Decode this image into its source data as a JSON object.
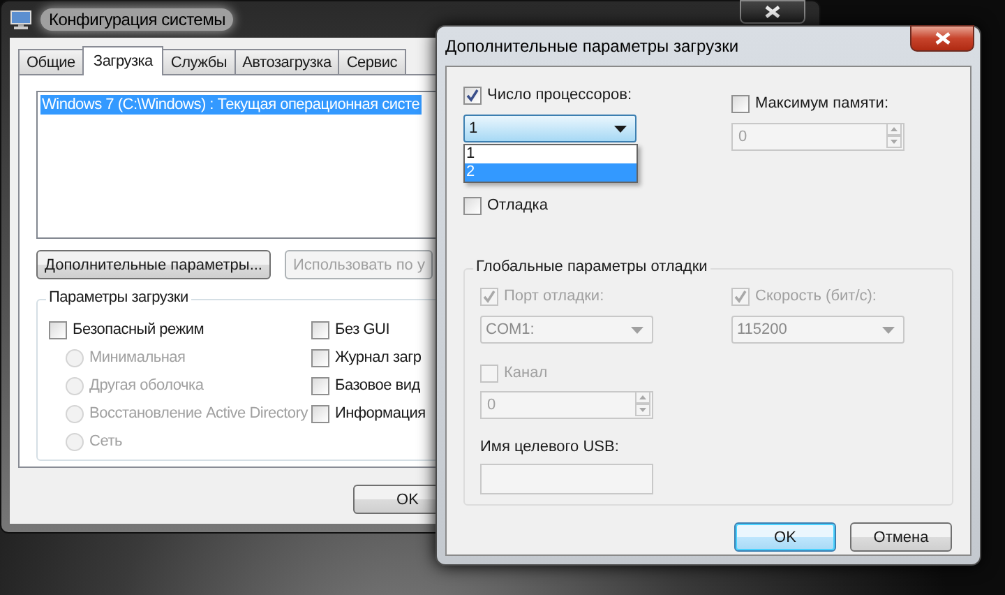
{
  "system_window": {
    "title": "Конфигурация системы",
    "tabs": [
      {
        "label": "Общие",
        "selected": false
      },
      {
        "label": "Загрузка",
        "selected": true
      },
      {
        "label": "Службы",
        "selected": false
      },
      {
        "label": "Автозагрузка",
        "selected": false
      },
      {
        "label": "Сервис",
        "selected": false
      }
    ],
    "boot_entries": [
      {
        "text": "Windows 7 (C:\\Windows) : Текущая операционная систе",
        "selected": true
      }
    ],
    "buttons": [
      {
        "label": "Дополнительные параметры...",
        "disabled": false
      },
      {
        "label": "Использовать по у",
        "disabled": true
      }
    ],
    "boot_options": {
      "title": "Параметры загрузки",
      "safe_mode": {
        "label": "Безопасный режим",
        "checked": false
      },
      "modes": [
        {
          "label": "Минимальная",
          "selected": false,
          "disabled": true
        },
        {
          "label": "Другая оболочка",
          "selected": false,
          "disabled": true
        },
        {
          "label": "Восстановление Active Directory",
          "selected": false,
          "disabled": true
        },
        {
          "label": "Сеть",
          "selected": false,
          "disabled": true
        }
      ],
      "flags": [
        {
          "label": "Без GUI",
          "checked": false
        },
        {
          "label": "Журнал загр",
          "checked": false
        },
        {
          "label": "Базовое вид",
          "checked": false
        },
        {
          "label": "Информация",
          "checked": false
        }
      ]
    },
    "ok_button": "OK"
  },
  "advanced_dialog": {
    "title": "Дополнительные параметры загрузки",
    "processors": {
      "label": "Число процессоров:",
      "checked": true,
      "value": "1",
      "options": [
        {
          "label": "1",
          "highlighted": false
        },
        {
          "label": "2",
          "highlighted": true
        }
      ]
    },
    "max_memory": {
      "label": "Максимум памяти:",
      "checked": false,
      "value": "0"
    },
    "debug": {
      "label": "Отладка",
      "checked": false
    },
    "debug_settings": {
      "title": "Глобальные параметры отладки",
      "port": {
        "label": "Порт отладки:",
        "checked": true,
        "disabled": true,
        "value": "COM1:"
      },
      "baud": {
        "label": "Скорость (бит/с):",
        "checked": true,
        "disabled": true,
        "value": "115200"
      },
      "channel": {
        "label": "Канал",
        "checked": false,
        "disabled": true,
        "value": "0"
      },
      "usb_target": {
        "label": "Имя целевого USB:",
        "disabled": true
      }
    },
    "buttons": [
      {
        "label": "OK",
        "default": true
      },
      {
        "label": "Отмена",
        "default": false
      }
    ]
  }
}
